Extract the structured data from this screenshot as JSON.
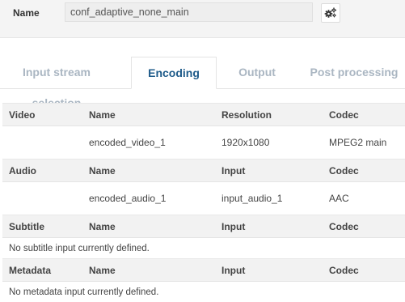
{
  "header": {
    "name_label": "Name",
    "name_value": "conf_adaptive_none_main"
  },
  "tabs": [
    {
      "label": "Input stream selection",
      "active": false
    },
    {
      "label": "Encoding",
      "active": true
    },
    {
      "label": "Output",
      "active": false
    },
    {
      "label": "Post processing",
      "active": false
    }
  ],
  "video": {
    "headers": [
      "Video",
      "Name",
      "Resolution",
      "Codec"
    ],
    "rows": [
      {
        "name": "encoded_video_1",
        "resolution": "1920x1080",
        "codec": "MPEG2 main"
      }
    ]
  },
  "audio": {
    "headers": [
      "Audio",
      "Name",
      "Input",
      "Codec"
    ],
    "rows": [
      {
        "name": "encoded_audio_1",
        "input": "input_audio_1",
        "codec": "AAC"
      }
    ]
  },
  "subtitle": {
    "headers": [
      "Subtitle",
      "Name",
      "Input",
      "Codec"
    ],
    "empty": "No subtitle input currently defined."
  },
  "metadata": {
    "headers": [
      "Metadata",
      "Name",
      "Input",
      "Codec"
    ],
    "empty": "No metadata input currently defined."
  },
  "colors": {
    "active_tab": "#1e5b8a",
    "inactive_tab": "#aab6c2"
  }
}
